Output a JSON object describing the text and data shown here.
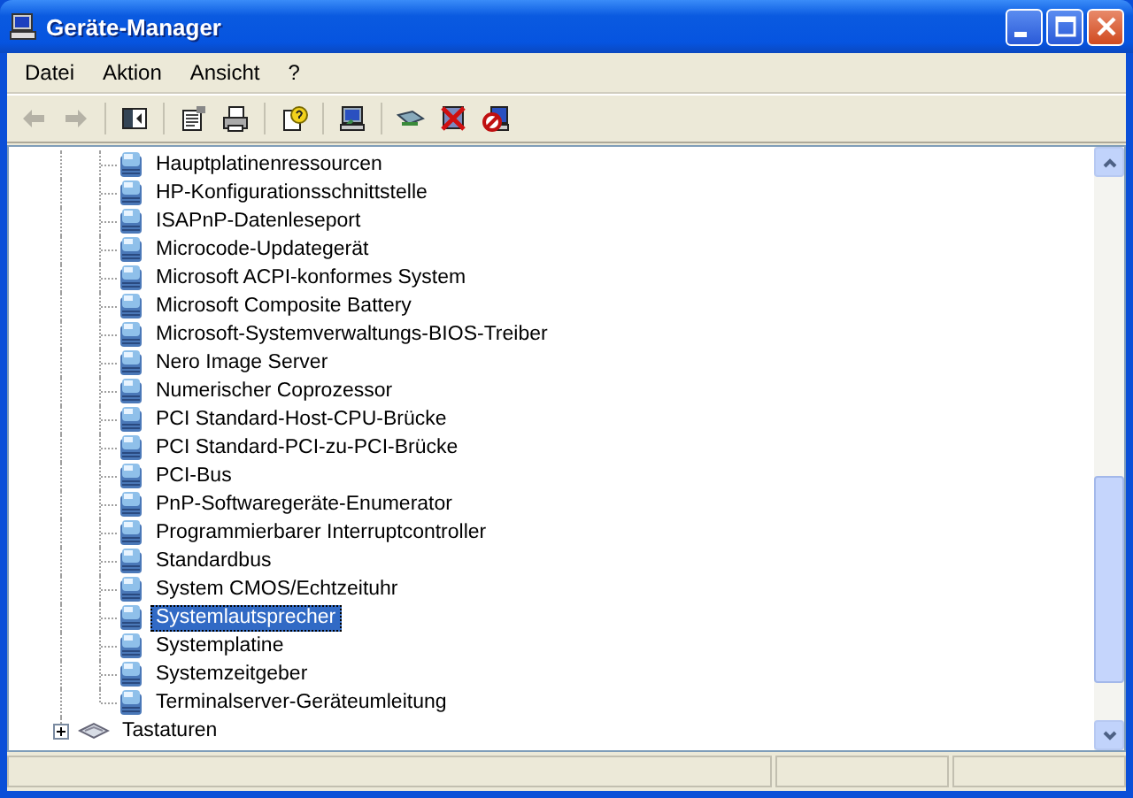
{
  "window": {
    "title": "Geräte-Manager"
  },
  "menu": [
    "Datei",
    "Aktion",
    "Ansicht",
    "?"
  ],
  "toolbar": [
    {
      "kind": "back",
      "disabled": true
    },
    {
      "kind": "forward",
      "disabled": true
    },
    {
      "kind": "sep"
    },
    {
      "kind": "tree"
    },
    {
      "kind": "sep"
    },
    {
      "kind": "properties"
    },
    {
      "kind": "print"
    },
    {
      "kind": "sep"
    },
    {
      "kind": "help"
    },
    {
      "kind": "sep"
    },
    {
      "kind": "scan"
    },
    {
      "kind": "sep"
    },
    {
      "kind": "update"
    },
    {
      "kind": "uninstall"
    },
    {
      "kind": "disable"
    }
  ],
  "tree": [
    {
      "expanded": true,
      "children": [
        {
          "label": "Hauptplatinenressourcen",
          "selected": false
        },
        {
          "label": "HP-Konfigurationsschnittstelle",
          "selected": false
        },
        {
          "label": "ISAPnP-Datenleseport",
          "selected": false
        },
        {
          "label": "Microcode-Updategerät",
          "selected": false
        },
        {
          "label": "Microsoft ACPI-konformes System",
          "selected": false
        },
        {
          "label": "Microsoft Composite Battery",
          "selected": false
        },
        {
          "label": "Microsoft-Systemverwaltungs-BIOS-Treiber",
          "selected": false
        },
        {
          "label": "Nero Image Server",
          "selected": false
        },
        {
          "label": "Numerischer Coprozessor",
          "selected": false
        },
        {
          "label": "PCI Standard-Host-CPU-Brücke",
          "selected": false
        },
        {
          "label": "PCI Standard-PCI-zu-PCI-Brücke",
          "selected": false
        },
        {
          "label": "PCI-Bus",
          "selected": false
        },
        {
          "label": "PnP-Softwaregeräte-Enumerator",
          "selected": false
        },
        {
          "label": "Programmierbarer Interruptcontroller",
          "selected": false
        },
        {
          "label": "Standardbus",
          "selected": false
        },
        {
          "label": "System CMOS/Echtzeituhr",
          "selected": false
        },
        {
          "label": "Systemlautsprecher",
          "selected": true
        },
        {
          "label": "Systemplatine",
          "selected": false
        },
        {
          "label": "Systemzeitgeber",
          "selected": false
        },
        {
          "label": "Terminalserver-Geräteumleitung",
          "selected": false
        }
      ]
    },
    {
      "label": "Tastaturen",
      "expanded": false,
      "selected": false
    }
  ]
}
